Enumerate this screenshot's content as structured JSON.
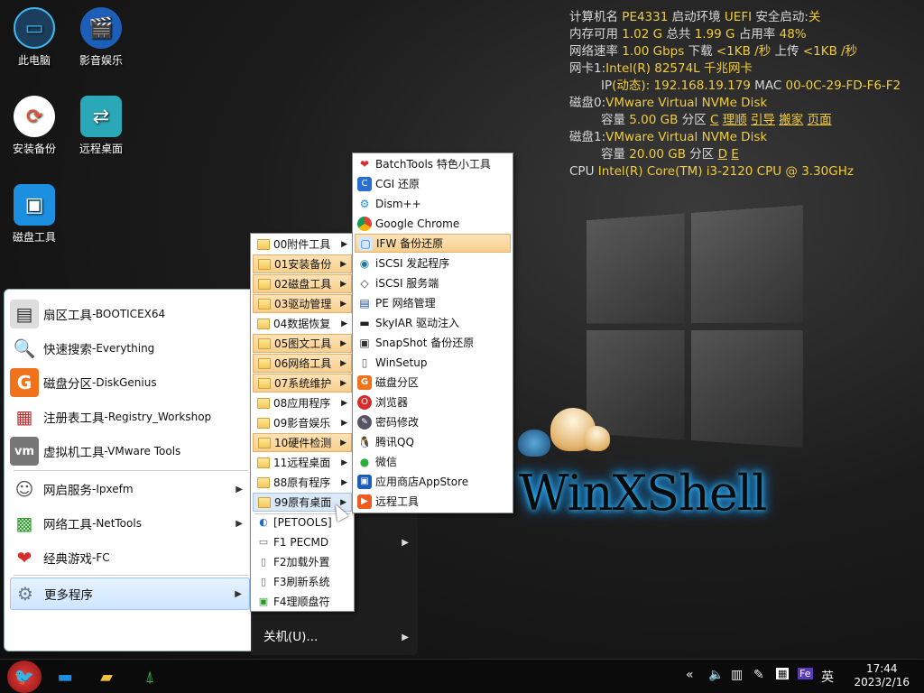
{
  "desktop_icons": [
    {
      "label": "此电脑",
      "icon": "computer-icon"
    },
    {
      "label": "影音娱乐",
      "icon": "media-icon"
    },
    {
      "label": "安装备份",
      "icon": "install-backup-icon"
    },
    {
      "label": "远程桌面",
      "icon": "remote-desktop-icon"
    },
    {
      "label": "磁盘工具",
      "icon": "disk-tool-icon"
    }
  ],
  "sysinfo": {
    "line1": {
      "k1": "计算机名",
      "v1": "PE4331",
      "k2": "启动环境",
      "v2": "UEFI",
      "k3": "安全启动:",
      "v3": "关"
    },
    "line2": {
      "k1": "内存可用",
      "v1": "1.02 G",
      "k2": "总共",
      "v2": "1.99 G",
      "k3": "占用率",
      "v3": "48%"
    },
    "line3": {
      "k1": "网络速率",
      "v1": "1.00 Gbps",
      "k2": "下载",
      "v2": "<1KB /秒",
      "k3": "上传",
      "v3": "<1KB /秒"
    },
    "line4": {
      "k1": "网卡1:",
      "v1": "Intel(R) 82574L 千兆网卡"
    },
    "line5": {
      "k1": "IP",
      "k1b": "(动态):",
      "v1": "192.168.19.179",
      "k2": "MAC",
      "v2": "00-0C-29-FD-F6-F2"
    },
    "line6": {
      "k1": "磁盘0:",
      "v1": "VMware Virtual NVMe Disk"
    },
    "line7": {
      "k1": "容量",
      "v1": "5.00 GB",
      "k2": "分区",
      "v2": "C",
      "l1": "理顺",
      "l2": "引导",
      "l3": "搬家",
      "l4": "页面"
    },
    "line8": {
      "k1": "磁盘1:",
      "v1": "VMware Virtual NVMe Disk"
    },
    "line9": {
      "k1": "容量",
      "v1": "20.00 GB",
      "k2": "分区",
      "v2": "D",
      "v3": "E"
    },
    "line10": {
      "k1": "CPU",
      "v1": "Intel(R) Core(TM) i3-2120 CPU @ 3.30GHz"
    }
  },
  "wallpaper_text": "WinXShell",
  "start_menu": {
    "items": [
      {
        "name": "扇区工具",
        "sub": "-BOOTICEX64",
        "icon": "sector-tool-icon"
      },
      {
        "name": "快速搜索",
        "sub": "-Everything",
        "icon": "search-icon"
      },
      {
        "name": "磁盘分区",
        "sub": "-DiskGenius",
        "icon": "diskgenius-icon"
      },
      {
        "name": "注册表工具",
        "sub": "-Registry_Workshop",
        "icon": "registry-icon"
      },
      {
        "name": "虚拟机工具",
        "sub": "-VMware Tools",
        "icon": "vmware-icon"
      },
      {
        "name": "网启服务",
        "sub": "-Ipxefm",
        "icon": "network-boot-icon"
      },
      {
        "name": "网络工具",
        "sub": "-NetTools",
        "icon": "network-tools-icon"
      },
      {
        "name": "经典游戏",
        "sub": "-FC",
        "icon": "heart-game-icon"
      },
      {
        "name": "更多程序",
        "sub": "",
        "icon": "gear-icon"
      }
    ],
    "shutdown": "关机(U)..."
  },
  "submenu1": {
    "items": [
      "00附件工具",
      "01安装备份",
      "02磁盘工具",
      "03驱动管理",
      "04数据恢复",
      "05图文工具",
      "06网络工具",
      "07系统维护",
      "08应用程序",
      "09影音娱乐",
      "10硬件检测",
      "11远程桌面",
      "88原有程序",
      "99原有桌面"
    ],
    "extras": [
      "[PETOOLS]",
      "F1 PECMD",
      "F2加载外置",
      "F3刷新系统",
      "F4理顺盘符"
    ]
  },
  "submenu2": {
    "items": [
      {
        "label": "BatchTools 特色小工具",
        "icon": "heart-icon"
      },
      {
        "label": "CGI 还原",
        "icon": "cgi-icon"
      },
      {
        "label": "Dism++",
        "icon": "dism-icon"
      },
      {
        "label": "Google Chrome",
        "icon": "chrome-icon"
      },
      {
        "label": "IFW 备份还原",
        "icon": "ifw-icon"
      },
      {
        "label": "iSCSI 发起程序",
        "icon": "iscsi-icon"
      },
      {
        "label": "iSCSI 服务端",
        "icon": "iscsi-server-icon"
      },
      {
        "label": "PE 网络管理",
        "icon": "pe-network-icon"
      },
      {
        "label": "SkyIAR 驱动注入",
        "icon": "skyiar-icon"
      },
      {
        "label": "SnapShot 备份还原",
        "icon": "snapshot-icon"
      },
      {
        "label": "WinSetup",
        "icon": "winsetup-icon"
      },
      {
        "label": "磁盘分区",
        "icon": "diskgenius-icon"
      },
      {
        "label": "浏览器",
        "icon": "browser-icon"
      },
      {
        "label": "密码修改",
        "icon": "password-icon"
      },
      {
        "label": "腾讯QQ",
        "icon": "qq-icon"
      },
      {
        "label": "微信",
        "icon": "wechat-icon"
      },
      {
        "label": "应用商店AppStore",
        "icon": "appstore-icon"
      },
      {
        "label": "远程工具",
        "icon": "remote-tool-icon"
      }
    ]
  },
  "taskbar": {
    "tray_lang": "英",
    "time": "17:44",
    "date": "2023/2/16"
  }
}
